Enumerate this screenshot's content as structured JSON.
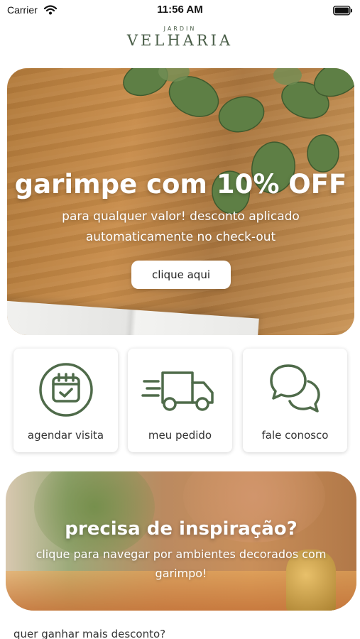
{
  "status_bar": {
    "carrier": "Carrier",
    "time": "11:56 AM"
  },
  "logo": {
    "small": "JARDIN",
    "big": "VELHARIA"
  },
  "hero": {
    "title": "garimpe com 10% OFF",
    "subtitle": "para qualquer valor! desconto aplicado automaticamente no check-out",
    "button_label": "clique aqui"
  },
  "actions": [
    {
      "label": "agendar visita",
      "icon": "calendar-check-icon"
    },
    {
      "label": "meu pedido",
      "icon": "delivery-truck-icon"
    },
    {
      "label": "fale conosco",
      "icon": "chat-bubbles-icon"
    }
  ],
  "inspiration": {
    "title": "precisa de inspiração?",
    "subtitle": "clique para navegar por ambientes decorados com garimpo!"
  },
  "footer_prompt": "quer ganhar mais desconto?",
  "colors": {
    "brand_green": "#4a5e48",
    "icon_green": "#4f6b4a"
  }
}
